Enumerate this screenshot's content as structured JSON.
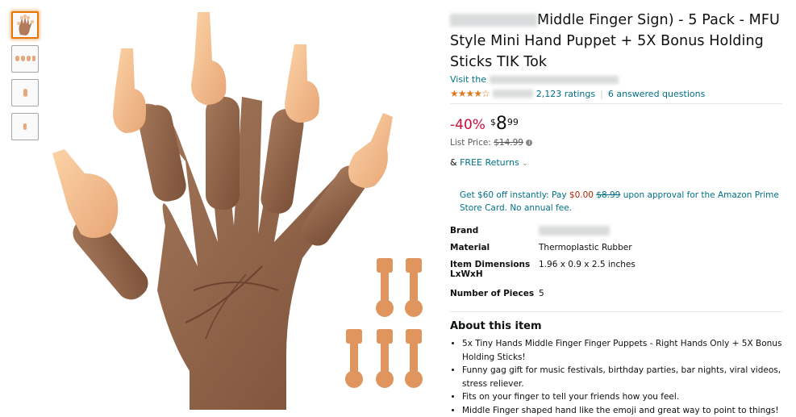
{
  "product": {
    "title_redacted_prefix": "",
    "title": "Middle Finger Sign) - 5 Pack - MFU Style Mini Hand Puppet + 5X Bonus Holding Sticks TIK Tok",
    "visit_store_label": "Visit the",
    "ratings_count": "2,123 ratings",
    "answered_questions": "6 answered questions",
    "stars": "★★★★☆"
  },
  "pricing": {
    "discount": "-40%",
    "price_symbol": "$",
    "price_whole": "8",
    "price_fraction": "99",
    "list_price_label": "List Price:",
    "list_price_value": "$14.99",
    "returns_amp": "&",
    "returns_label": "FREE Returns",
    "promo_text_1": "Get $60 off instantly: Pay",
    "promo_price": "$0.00",
    "promo_strike": "$8.99",
    "promo_text_2": "upon approval for the Amazon Prime Store Card. No annual fee."
  },
  "specs": [
    {
      "key": "Brand",
      "value": ""
    },
    {
      "key": "Material",
      "value": "Thermoplastic Rubber"
    },
    {
      "key": "Item Dimensions LxWxH",
      "value": "1.96 x 0.9 x 2.5 inches"
    },
    {
      "key": "Number of Pieces",
      "value": "5"
    }
  ],
  "about": {
    "heading": "About this item",
    "bullets": [
      "5x Tiny Hands Middle Finger Finger Puppets - Right Hands Only + 5X Bonus Holding Sticks!",
      "Funny gag gift for music festivals, birthday parties, bar nights, viral videos, stress reliever.",
      "Fits on your finger to tell your friends how you feel.",
      "Middle Finger shaped hand like the emoji and great way to point to things!"
    ]
  },
  "colors": {
    "link": "#007185",
    "discount": "#cc0c39",
    "star": "#de7921",
    "thumb_active": "#e77600"
  },
  "icons": [
    "chevron-down-icon",
    "info-icon",
    "star-rating-icon"
  ]
}
